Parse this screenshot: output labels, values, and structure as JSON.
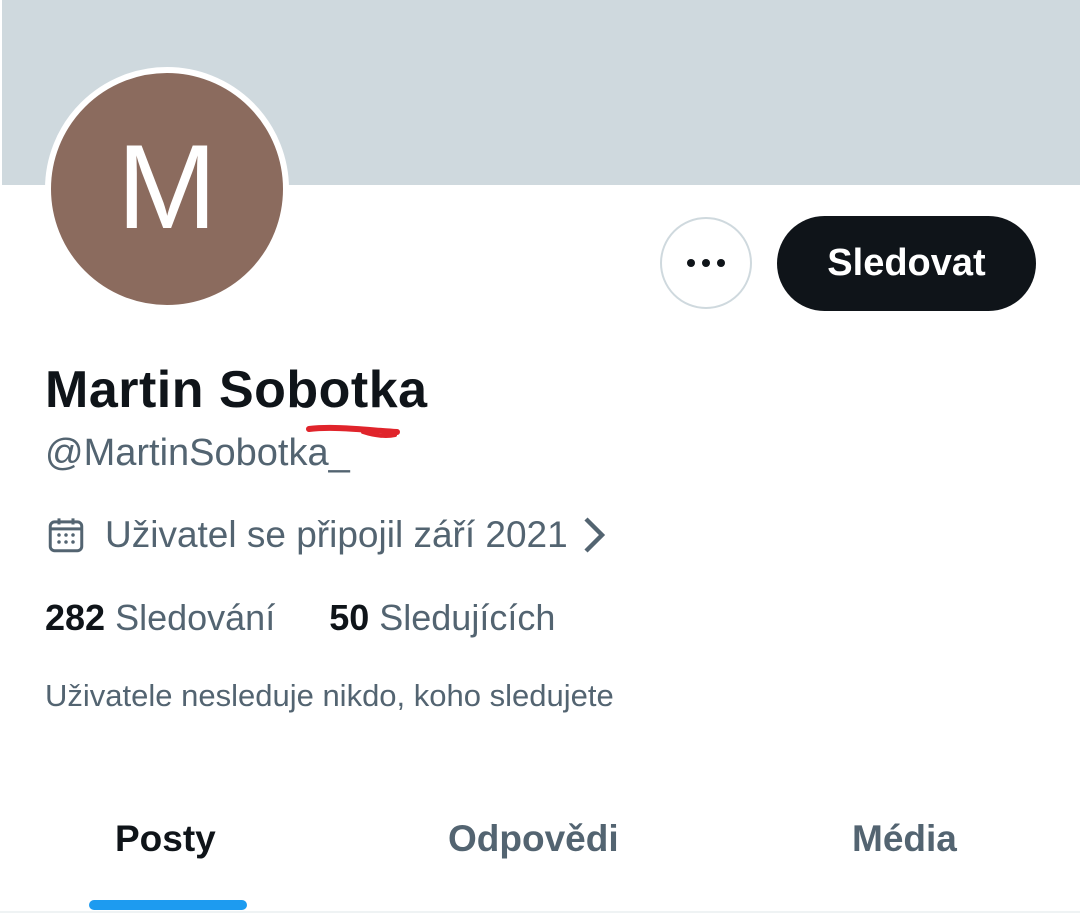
{
  "profile": {
    "avatar_letter": "M",
    "display_name": "Martin Sobotka",
    "handle": "@MartinSobotka_",
    "joined": "Uživatel se připojil září 2021",
    "following_count": "282",
    "following_label": "Sledování",
    "followers_count": "50",
    "followers_label": "Sledujících",
    "no_followers_note": "Uživatele nesleduje nikdo, koho sledujete"
  },
  "actions": {
    "more_icon": "ellipsis-icon",
    "follow_label": "Sledovat"
  },
  "tabs": [
    {
      "label": "Posty",
      "active": true
    },
    {
      "label": "Odpovědi",
      "active": false
    },
    {
      "label": "Média",
      "active": false
    }
  ],
  "colors": {
    "banner": "#cfd9de",
    "avatar": "#8b6b5e",
    "accent": "#1d9bf0",
    "annotation": "#e0242b"
  }
}
